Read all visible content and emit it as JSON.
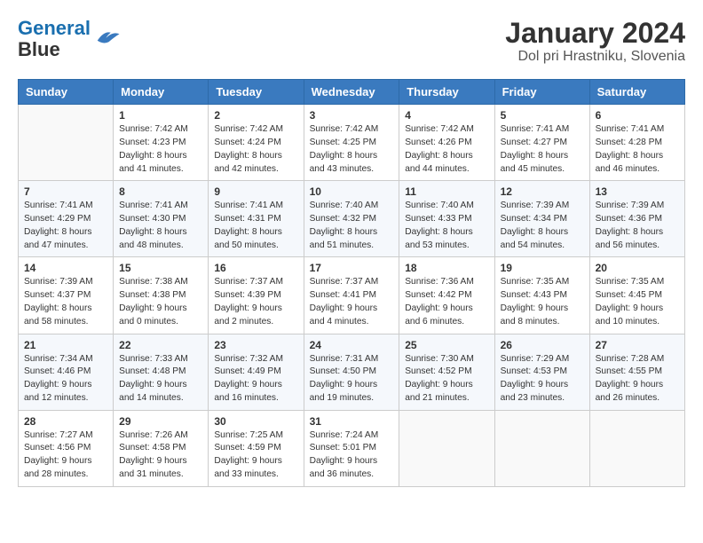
{
  "header": {
    "logo_line1": "General",
    "logo_line2": "Blue",
    "title": "January 2024",
    "subtitle": "Dol pri Hrastniku, Slovenia"
  },
  "calendar": {
    "weekdays": [
      "Sunday",
      "Monday",
      "Tuesday",
      "Wednesday",
      "Thursday",
      "Friday",
      "Saturday"
    ],
    "weeks": [
      [
        {
          "day": "",
          "info": ""
        },
        {
          "day": "1",
          "info": "Sunrise: 7:42 AM\nSunset: 4:23 PM\nDaylight: 8 hours\nand 41 minutes."
        },
        {
          "day": "2",
          "info": "Sunrise: 7:42 AM\nSunset: 4:24 PM\nDaylight: 8 hours\nand 42 minutes."
        },
        {
          "day": "3",
          "info": "Sunrise: 7:42 AM\nSunset: 4:25 PM\nDaylight: 8 hours\nand 43 minutes."
        },
        {
          "day": "4",
          "info": "Sunrise: 7:42 AM\nSunset: 4:26 PM\nDaylight: 8 hours\nand 44 minutes."
        },
        {
          "day": "5",
          "info": "Sunrise: 7:41 AM\nSunset: 4:27 PM\nDaylight: 8 hours\nand 45 minutes."
        },
        {
          "day": "6",
          "info": "Sunrise: 7:41 AM\nSunset: 4:28 PM\nDaylight: 8 hours\nand 46 minutes."
        }
      ],
      [
        {
          "day": "7",
          "info": "Sunrise: 7:41 AM\nSunset: 4:29 PM\nDaylight: 8 hours\nand 47 minutes."
        },
        {
          "day": "8",
          "info": "Sunrise: 7:41 AM\nSunset: 4:30 PM\nDaylight: 8 hours\nand 48 minutes."
        },
        {
          "day": "9",
          "info": "Sunrise: 7:41 AM\nSunset: 4:31 PM\nDaylight: 8 hours\nand 50 minutes."
        },
        {
          "day": "10",
          "info": "Sunrise: 7:40 AM\nSunset: 4:32 PM\nDaylight: 8 hours\nand 51 minutes."
        },
        {
          "day": "11",
          "info": "Sunrise: 7:40 AM\nSunset: 4:33 PM\nDaylight: 8 hours\nand 53 minutes."
        },
        {
          "day": "12",
          "info": "Sunrise: 7:39 AM\nSunset: 4:34 PM\nDaylight: 8 hours\nand 54 minutes."
        },
        {
          "day": "13",
          "info": "Sunrise: 7:39 AM\nSunset: 4:36 PM\nDaylight: 8 hours\nand 56 minutes."
        }
      ],
      [
        {
          "day": "14",
          "info": "Sunrise: 7:39 AM\nSunset: 4:37 PM\nDaylight: 8 hours\nand 58 minutes."
        },
        {
          "day": "15",
          "info": "Sunrise: 7:38 AM\nSunset: 4:38 PM\nDaylight: 9 hours\nand 0 minutes."
        },
        {
          "day": "16",
          "info": "Sunrise: 7:37 AM\nSunset: 4:39 PM\nDaylight: 9 hours\nand 2 minutes."
        },
        {
          "day": "17",
          "info": "Sunrise: 7:37 AM\nSunset: 4:41 PM\nDaylight: 9 hours\nand 4 minutes."
        },
        {
          "day": "18",
          "info": "Sunrise: 7:36 AM\nSunset: 4:42 PM\nDaylight: 9 hours\nand 6 minutes."
        },
        {
          "day": "19",
          "info": "Sunrise: 7:35 AM\nSunset: 4:43 PM\nDaylight: 9 hours\nand 8 minutes."
        },
        {
          "day": "20",
          "info": "Sunrise: 7:35 AM\nSunset: 4:45 PM\nDaylight: 9 hours\nand 10 minutes."
        }
      ],
      [
        {
          "day": "21",
          "info": "Sunrise: 7:34 AM\nSunset: 4:46 PM\nDaylight: 9 hours\nand 12 minutes."
        },
        {
          "day": "22",
          "info": "Sunrise: 7:33 AM\nSunset: 4:48 PM\nDaylight: 9 hours\nand 14 minutes."
        },
        {
          "day": "23",
          "info": "Sunrise: 7:32 AM\nSunset: 4:49 PM\nDaylight: 9 hours\nand 16 minutes."
        },
        {
          "day": "24",
          "info": "Sunrise: 7:31 AM\nSunset: 4:50 PM\nDaylight: 9 hours\nand 19 minutes."
        },
        {
          "day": "25",
          "info": "Sunrise: 7:30 AM\nSunset: 4:52 PM\nDaylight: 9 hours\nand 21 minutes."
        },
        {
          "day": "26",
          "info": "Sunrise: 7:29 AM\nSunset: 4:53 PM\nDaylight: 9 hours\nand 23 minutes."
        },
        {
          "day": "27",
          "info": "Sunrise: 7:28 AM\nSunset: 4:55 PM\nDaylight: 9 hours\nand 26 minutes."
        }
      ],
      [
        {
          "day": "28",
          "info": "Sunrise: 7:27 AM\nSunset: 4:56 PM\nDaylight: 9 hours\nand 28 minutes."
        },
        {
          "day": "29",
          "info": "Sunrise: 7:26 AM\nSunset: 4:58 PM\nDaylight: 9 hours\nand 31 minutes."
        },
        {
          "day": "30",
          "info": "Sunrise: 7:25 AM\nSunset: 4:59 PM\nDaylight: 9 hours\nand 33 minutes."
        },
        {
          "day": "31",
          "info": "Sunrise: 7:24 AM\nSunset: 5:01 PM\nDaylight: 9 hours\nand 36 minutes."
        },
        {
          "day": "",
          "info": ""
        },
        {
          "day": "",
          "info": ""
        },
        {
          "day": "",
          "info": ""
        }
      ]
    ]
  }
}
